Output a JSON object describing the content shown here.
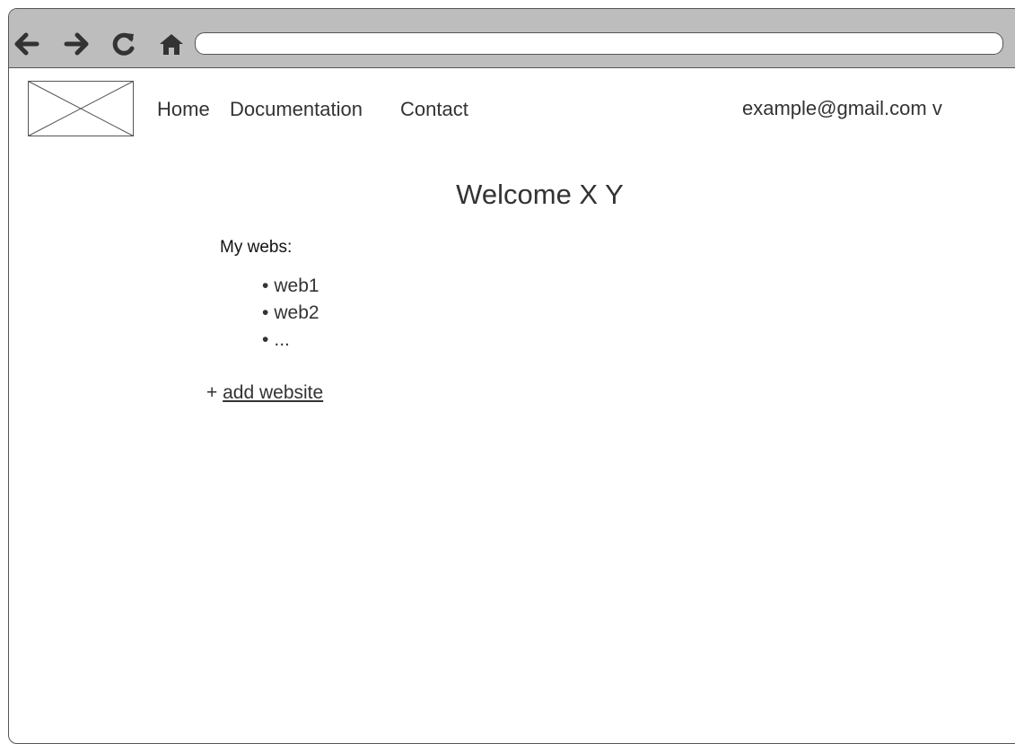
{
  "toolbar": {
    "back_icon": "arrow-left-icon",
    "forward_icon": "arrow-right-icon",
    "reload_icon": "reload-icon",
    "home_icon": "home-icon",
    "url": ""
  },
  "header": {
    "logo": "image-placeholder",
    "nav": [
      "Home",
      "Documentation",
      "Contact"
    ],
    "account": "example@gmail.com v"
  },
  "main": {
    "title": "Welcome X Y",
    "webs_label": "My webs:",
    "bullet": "•",
    "webs": [
      "web1",
      "web2",
      "..."
    ],
    "add_prefix": "+",
    "add_label": "add website"
  },
  "colors": {
    "toolbar_bg": "#bdbdbd",
    "text": "#333333",
    "border": "#555555"
  }
}
